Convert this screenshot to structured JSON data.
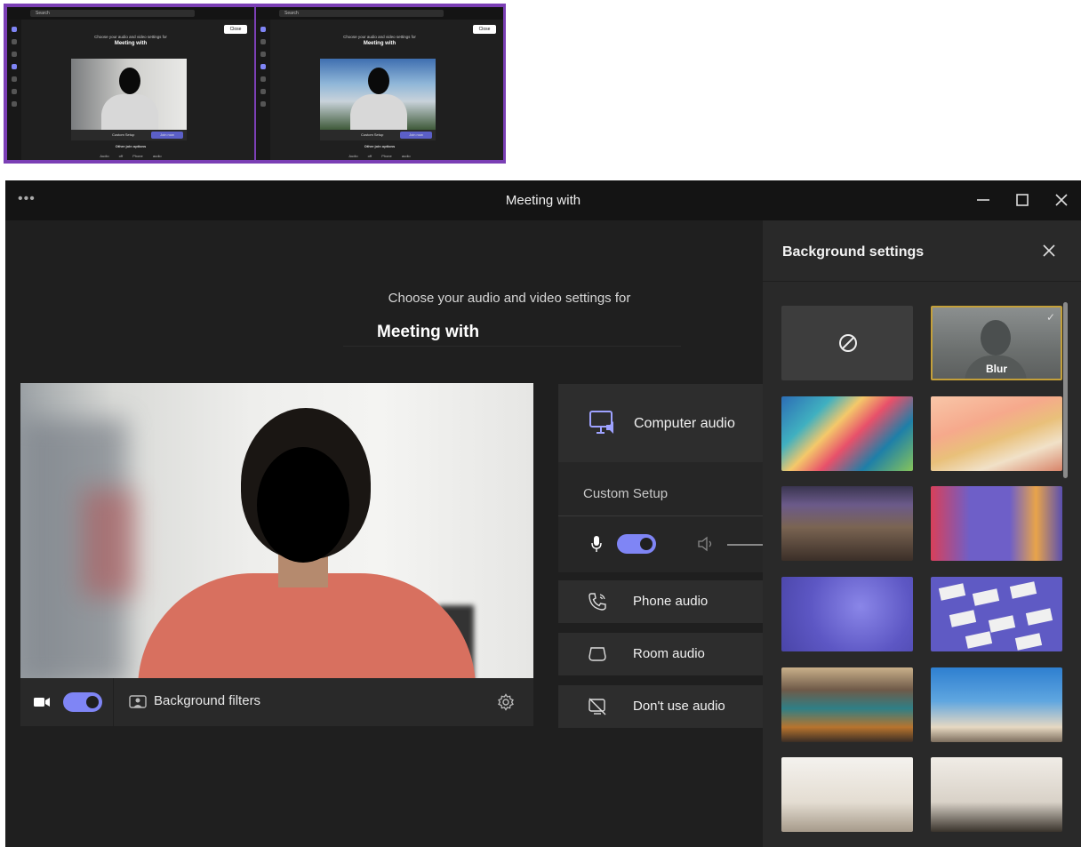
{
  "thumbnails": [
    {
      "search": "Search",
      "close": "Close",
      "subtitle": "Choose your audio and video settings for",
      "title": "Meeting with",
      "custom_setup": "Custom Setup",
      "join": "Join now",
      "other_options": "Other join options",
      "audio_off": "Audio off",
      "phone_audio": "Phone audio",
      "background": "blur"
    },
    {
      "search": "Search",
      "close": "Close",
      "subtitle": "Choose your audio and video settings for",
      "title": "Meeting with",
      "custom_setup": "Custom Setup",
      "join": "Join now",
      "other_options": "Other join options",
      "audio_off": "Audio off",
      "phone_audio": "Phone audio",
      "background": "office-building"
    }
  ],
  "window": {
    "title": "Meeting with",
    "menu_icon": "more-horizontal-icon",
    "controls": [
      "minimize-icon",
      "maximize-icon",
      "close-icon"
    ]
  },
  "prejoin": {
    "subtitle": "Choose your audio and video settings for",
    "meeting_title": "Meeting with"
  },
  "video_controls": {
    "camera_on": true,
    "background_filters": "Background filters"
  },
  "audio": {
    "computer_audio": "Computer audio",
    "custom_setup": "Custom Setup",
    "mic_on": true,
    "options": [
      "Phone audio",
      "Room audio",
      "Don't use audio"
    ]
  },
  "background_panel": {
    "title": "Background settings",
    "tiles": [
      {
        "name": "none",
        "label": ""
      },
      {
        "name": "blur",
        "label": "Blur",
        "selected": true
      },
      {
        "name": "abstract-waves",
        "label": ""
      },
      {
        "name": "pastel-scene",
        "label": ""
      },
      {
        "name": "lounge-room",
        "label": ""
      },
      {
        "name": "colorful-office",
        "label": ""
      },
      {
        "name": "purple-bubbles",
        "label": ""
      },
      {
        "name": "purple-notes",
        "label": ""
      },
      {
        "name": "industrial-office",
        "label": ""
      },
      {
        "name": "beach-sky",
        "label": ""
      },
      {
        "name": "white-room",
        "label": ""
      },
      {
        "name": "bright-room",
        "label": ""
      }
    ]
  },
  "colors": {
    "accent": "#7f85f5",
    "panel": "#292929",
    "window": "#1f1f1f",
    "selected_border": "#c4a03a"
  }
}
